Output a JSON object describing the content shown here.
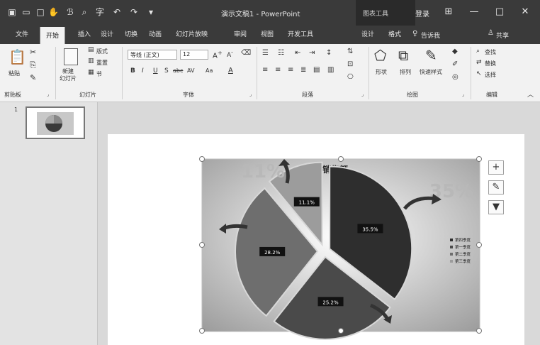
{
  "titlebar": {
    "doc_title": "演示文稿1 - PowerPoint",
    "context_group_label": "图表工具",
    "login": "登录",
    "icons": [
      "save-icon",
      "open-icon",
      "new-icon",
      "touch-mode-icon",
      "format-painter-icon",
      "preview-icon",
      "spell-icon",
      "undo-icon",
      "redo-icon",
      "customize-icon"
    ]
  },
  "tabs": {
    "items": [
      "文件",
      "开始",
      "插入",
      "设计",
      "切换",
      "动画",
      "幻灯片放映",
      "审阅",
      "视图",
      "开发工具",
      "设计",
      "格式"
    ],
    "active": "开始",
    "tell_me": "告诉我",
    "share": "共享"
  },
  "ribbon": {
    "clipboard": {
      "label": "剪贴板",
      "paste": "粘贴"
    },
    "slides": {
      "label": "幻灯片",
      "new_slide": "新建\n幻灯片",
      "layout": "版式",
      "reset": "重置",
      "section": "节"
    },
    "font": {
      "label": "字体",
      "font_name": "等线 (正文)",
      "font_size": "12",
      "bold": "B",
      "italic": "I",
      "underline": "U",
      "shadow": "S",
      "strike": "abc",
      "spacing": "AV",
      "case": "Aa",
      "color": "A"
    },
    "paragraph": {
      "label": "段落"
    },
    "drawing": {
      "label": "绘图",
      "shape": "形状",
      "arrange": "排列",
      "quick_styles": "快速样式"
    },
    "editing": {
      "label": "编辑",
      "find": "查找",
      "replace": "替换",
      "select": "选择"
    }
  },
  "thumbs": {
    "slide_number": "1"
  },
  "chart_data": {
    "type": "pie",
    "title": "销售额",
    "categories": [
      "第一季度",
      "第二季度",
      "第三季度",
      "第四季度"
    ],
    "values": [
      35.5,
      25.2,
      28.2,
      11.1
    ],
    "data_labels": [
      "35.5%",
      "25.2%",
      "28.2%",
      "11.1%"
    ],
    "callout_labels": [
      "35%",
      "11%"
    ],
    "legend": [
      "第四季度",
      "第一季度",
      "第二季度",
      "第三季度"
    ],
    "legend_position": "right",
    "colors": [
      "#2e2e2e",
      "#4a4a4a",
      "#6e6e6e",
      "#9c9c9c"
    ]
  }
}
